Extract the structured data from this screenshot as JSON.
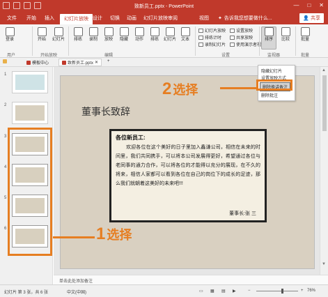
{
  "window": {
    "title": "致新员工.pptx - PowerPoint",
    "controls": [
      "—",
      "□",
      "✕"
    ]
  },
  "tabs": {
    "items": [
      {
        "label": "文件"
      },
      {
        "label": "开始"
      },
      {
        "label": "插入"
      },
      {
        "label": "幻灯片放映"
      },
      {
        "label": "设计"
      },
      {
        "label": "切换"
      },
      {
        "label": "动画"
      },
      {
        "label": "幻灯片放映"
      },
      {
        "label": "审阅"
      },
      {
        "label": "视图"
      }
    ],
    "active_label": "幻灯片放映",
    "tell_me": "告诉我您想要做什么...",
    "share": "共享"
  },
  "ribbon": {
    "buttons": [
      {
        "label": "登录"
      },
      {
        "label": "开始"
      },
      {
        "label": "幻灯片"
      },
      {
        "label": "排练"
      },
      {
        "label": "录制"
      },
      {
        "label": "放映"
      },
      {
        "label": "隐藏"
      },
      {
        "label": "动作"
      },
      {
        "label": "排练"
      },
      {
        "label": "幻灯片"
      },
      {
        "label": "文本"
      },
      {
        "label": "排序"
      },
      {
        "label": "比较"
      },
      {
        "label": "批量"
      }
    ],
    "small_items": [
      "幻灯片放映",
      "排练计时",
      "录制幻灯片",
      "设置放映",
      "共享放映",
      "设置幻灯片",
      "使用演示者视图"
    ],
    "groups": [
      "用户",
      "开始放映",
      "编辑",
      "设置",
      "监视器",
      "批量"
    ],
    "highlighted_button": "设置幻灯片放映"
  },
  "docbar": {
    "items": [
      "模板中心",
      "致新员工.pptx"
    ],
    "add": "+"
  },
  "dropdown": {
    "items": [
      "隐藏幻灯片",
      "设置放映方式",
      "删除换讲备注",
      "删除批注"
    ],
    "highlighted": "删除换讲备注"
  },
  "thumbnails": [
    {
      "num": "1"
    },
    {
      "num": "2"
    },
    {
      "num": "3"
    },
    {
      "num": "4"
    },
    {
      "num": "5"
    },
    {
      "num": "6"
    }
  ],
  "slide": {
    "title": "董事长致辞",
    "greeting": "各位新员工:",
    "body": "欢迎各位在这个美好的日子里加入鑫谦公司，相信在未来的时间里，我们共同携手，可以将本公司发展得更好，希望通过各位与老同事的通力合作，可以将各位的才能得以充分的展现，在不久的将来，相信人家都可以看到各位在自己的岗位下的成长的足迹，那么我们就朝着这美好的未来吧!!!",
    "signature": "董事长:张 三"
  },
  "notes": {
    "placeholder": "单击此处添加备注"
  },
  "status": {
    "slide_info": "幻灯片 第 3 张，共 6 张",
    "language": "中文(中国)",
    "zoom": "76%"
  },
  "annotations": {
    "step1_num": "1",
    "step1_text": "选择",
    "step2_num": "2",
    "step2_text": "选择"
  },
  "colors": {
    "accent": "#c0392b",
    "annotation": "#e67e22",
    "slide_bg": "#d9d0c1"
  }
}
